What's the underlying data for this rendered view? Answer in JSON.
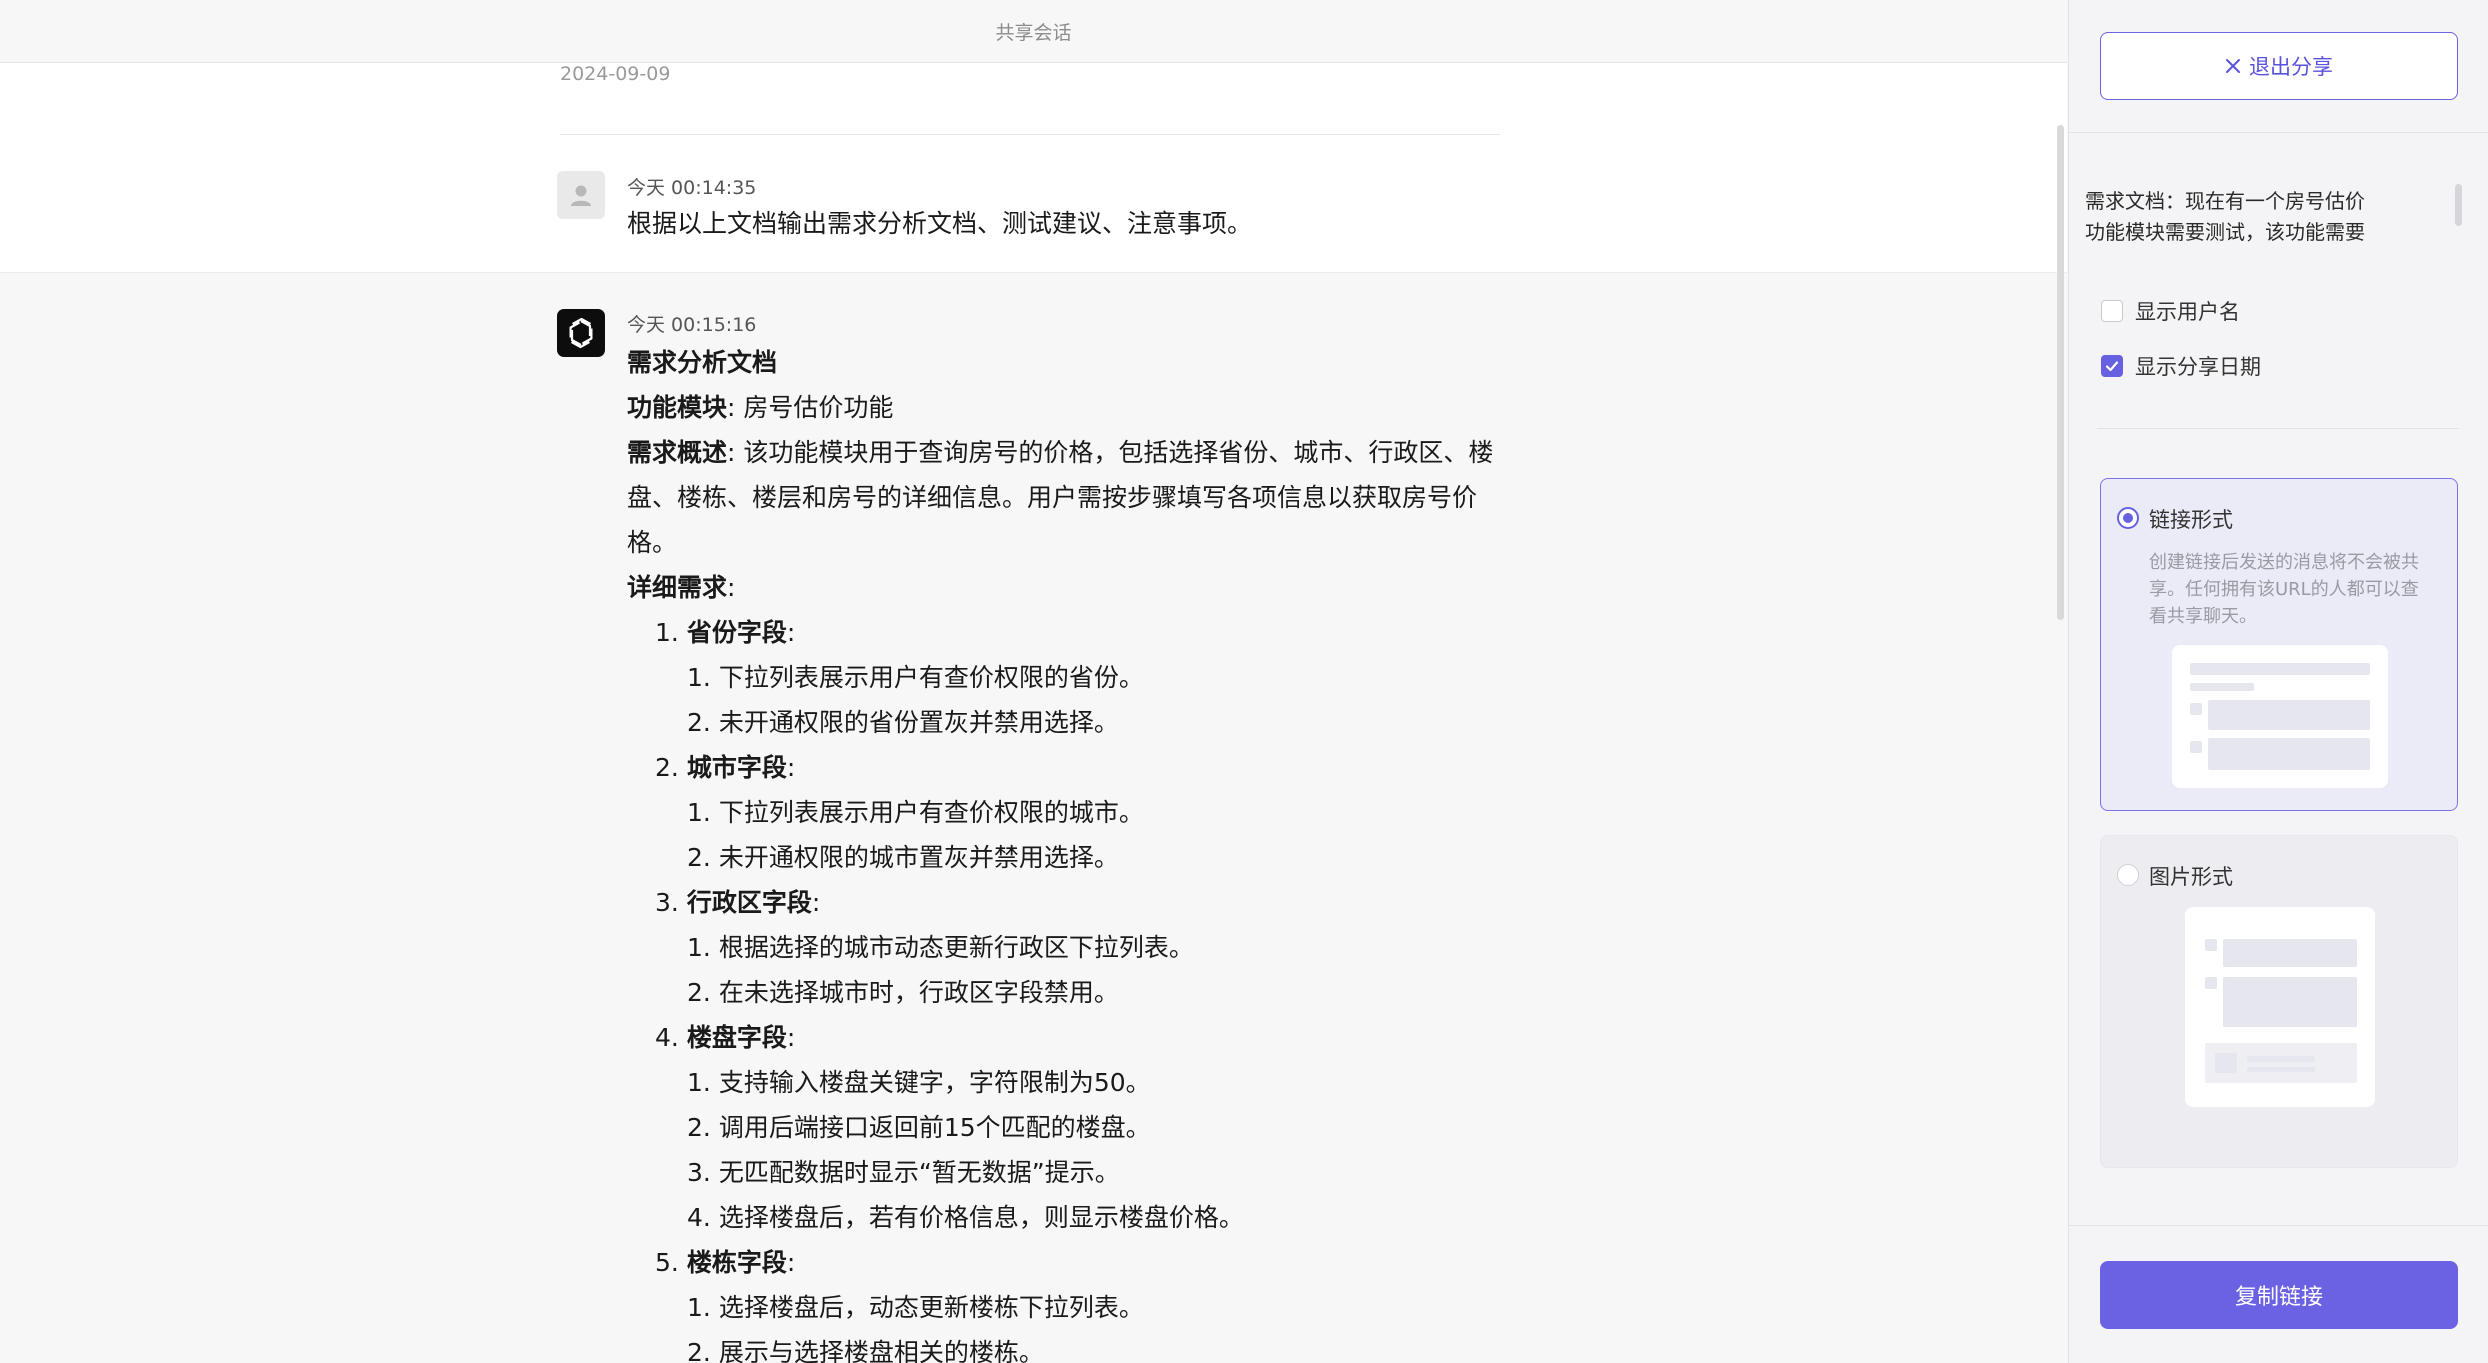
{
  "header": {
    "title": "共享会话"
  },
  "share_date": "2024-09-09",
  "user_message": {
    "time": "今天 00:14:35",
    "text": "根据以上文档输出需求分析文档、测试建议、注意事项。"
  },
  "assistant_message": {
    "time": "今天 00:15:16",
    "heading": "需求分析文档",
    "module_label": "功能模块",
    "module_value": ": 房号估价功能",
    "overview_label": "需求概述",
    "overview_line1": ": 该功能模块用于查询房号的价格，包括选择省份、城市、行政区、楼",
    "overview_line2": "盘、楼栋、楼层和房号的详细信息。用户需按步骤填写各项信息以获取房号价",
    "overview_line3": "格。",
    "details_label": "详细需求",
    "colon": ":",
    "sections": [
      {
        "num": "1.",
        "title": "省份字段",
        "items": [
          {
            "num": "1.",
            "text": "下拉列表展示用户有查价权限的省份。"
          },
          {
            "num": "2.",
            "text": "未开通权限的省份置灰并禁用选择。"
          }
        ]
      },
      {
        "num": "2.",
        "title": "城市字段",
        "items": [
          {
            "num": "1.",
            "text": "下拉列表展示用户有查价权限的城市。"
          },
          {
            "num": "2.",
            "text": "未开通权限的城市置灰并禁用选择。"
          }
        ]
      },
      {
        "num": "3.",
        "title": "行政区字段",
        "items": [
          {
            "num": "1.",
            "text": "根据选择的城市动态更新行政区下拉列表。"
          },
          {
            "num": "2.",
            "text": "在未选择城市时，行政区字段禁用。"
          }
        ]
      },
      {
        "num": "4.",
        "title": "楼盘字段",
        "items": [
          {
            "num": "1.",
            "text": "支持输入楼盘关键字，字符限制为50。"
          },
          {
            "num": "2.",
            "text": "调用后端接口返回前15个匹配的楼盘。"
          },
          {
            "num": "3.",
            "text": "无匹配数据时显示“暂无数据”提示。"
          },
          {
            "num": "4.",
            "text": "选择楼盘后，若有价格信息，则显示楼盘价格。"
          }
        ]
      },
      {
        "num": "5.",
        "title": "楼栋字段",
        "items": [
          {
            "num": "1.",
            "text": "选择楼盘后，动态更新楼栋下拉列表。"
          },
          {
            "num": "2.",
            "text": "展示与选择楼盘相关的楼栋。"
          }
        ]
      }
    ]
  },
  "panel": {
    "exit_label": "退出分享",
    "doc_preview_line1": "需求文档：现在有一个房号估价",
    "doc_preview_line2": "功能模块需要测试，该功能需要",
    "show_username_label": "显示用户名",
    "show_username_checked": false,
    "show_date_label": "显示分享日期",
    "show_date_checked": true,
    "link_option": {
      "title": "链接形式",
      "desc": "创建链接后发送的消息将不会被共享。任何拥有该URL的人都可以查看共享聊天。",
      "selected": true
    },
    "image_option": {
      "title": "图片形式",
      "selected": false
    },
    "copy_label": "复制链接"
  },
  "colors": {
    "accent": "#6b62e3",
    "text": "#1a1a1a",
    "muted": "#9a9a9a"
  }
}
